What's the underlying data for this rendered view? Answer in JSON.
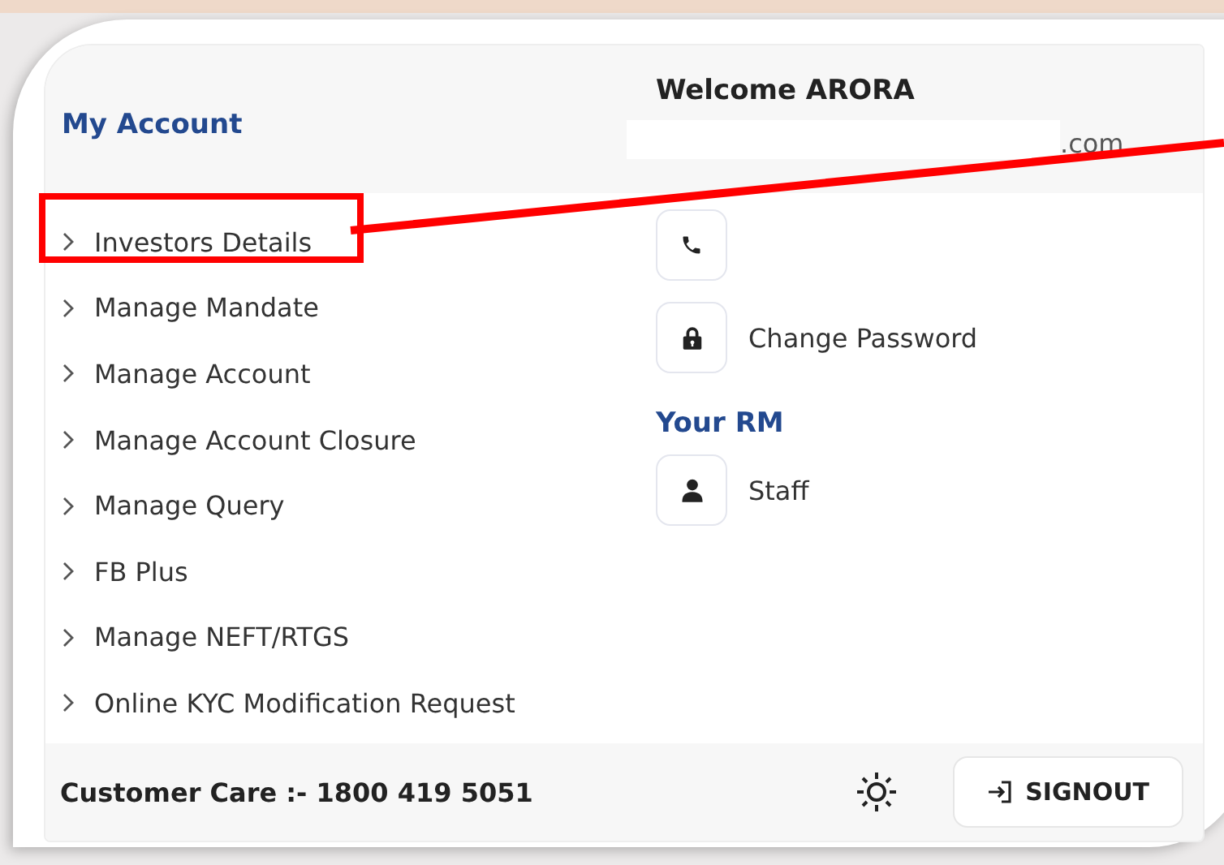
{
  "header": {
    "title": "My Account",
    "welcome": "Welcome ARORA",
    "email_visible": ".com"
  },
  "menu": [
    {
      "label": "Investors Details",
      "highlighted": true
    },
    {
      "label": "Manage Mandate",
      "highlighted": false
    },
    {
      "label": "Manage Account",
      "highlighted": false
    },
    {
      "label": "Manage Account Closure",
      "highlighted": false
    },
    {
      "label": "Manage Query",
      "highlighted": false
    },
    {
      "label": "FB Plus",
      "highlighted": false
    },
    {
      "label": "Manage NEFT/RTGS",
      "highlighted": false
    },
    {
      "label": "Online KYC Modification Request",
      "highlighted": false
    }
  ],
  "contact": [
    {
      "kind": "phone"
    },
    {
      "kind": "lock",
      "label": "Change Password"
    }
  ],
  "rm": {
    "title": "Your RM",
    "items": [
      {
        "kind": "person",
        "label": "Staff"
      }
    ]
  },
  "footer": {
    "customer_care": "Customer Care :- 1800 419 5051",
    "signout": "SIGNOUT"
  }
}
